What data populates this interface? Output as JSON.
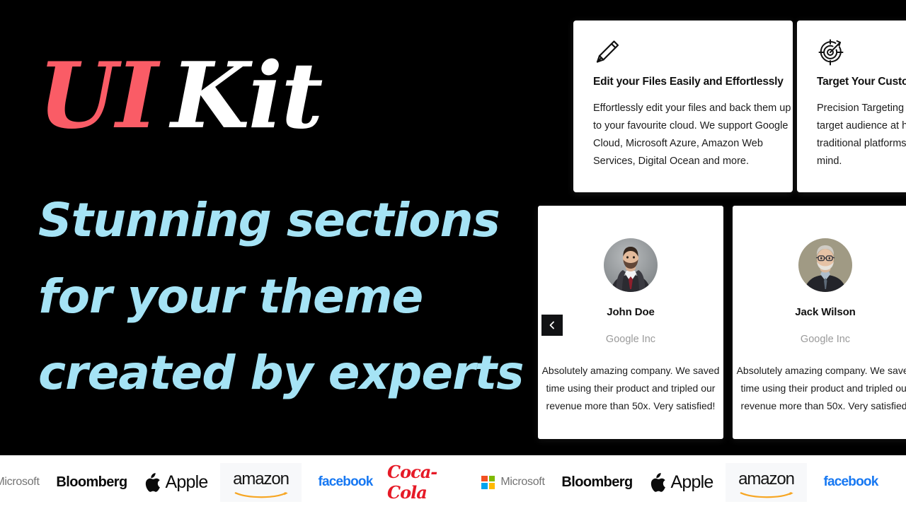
{
  "hero": {
    "title_part1": "UI",
    "title_part2": "Kit",
    "title_color_1": "#FA5C66",
    "title_color_2": "#FFFFFF",
    "subtitle_color": "#A5E3F5",
    "subtitle_lines": [
      "Stunning sections",
      "for your theme",
      "created by experts"
    ]
  },
  "features": [
    {
      "icon": "pencil-icon",
      "title": "Edit your Files Easily and Effortlessly",
      "body": "Effortlessly edit your files and back them up to your favourite cloud. We support Google Cloud, Microsoft Azure, Amazon Web Services, Digital Ocean and more."
    },
    {
      "icon": "target-icon",
      "title": "Target Your Customers",
      "body": "Precision Targeting allows you to reach your target audience at half the cost charged by traditional platforms and with enhanced mind."
    }
  ],
  "testimonials": {
    "prev_label": "‹",
    "items": [
      {
        "avatar": "avatar-john-doe",
        "name": "John Doe",
        "company": "Google Inc",
        "quote": "Absolutely amazing company. We saved time using their product and tripled our revenue more than 50x. Very satisfied!"
      },
      {
        "avatar": "avatar-jack-wilson",
        "name": "Jack Wilson",
        "company": "Google Inc",
        "quote": "Absolutely amazing company. We saved time using their product and tripled our revenue more than 50x. Very satisfied!"
      }
    ]
  },
  "logobar": {
    "background": "#FFFFFF",
    "logos": [
      {
        "name": "microsoft",
        "label": "Microsoft",
        "style": "microsoft",
        "color": "#737373"
      },
      {
        "name": "bloomberg",
        "label": "Bloomberg",
        "style": "bloomberg",
        "color": "#0B0B0B"
      },
      {
        "name": "apple",
        "label": "Apple",
        "style": "apple",
        "color": "#0B0B0B"
      },
      {
        "name": "amazon",
        "label": "amazon",
        "style": "amazon",
        "color": "#141414"
      },
      {
        "name": "facebook",
        "label": "facebook",
        "style": "facebook",
        "color": "#1778F2"
      },
      {
        "name": "coca-cola",
        "label": "Coca-Cola",
        "style": "coca",
        "color": "#E61A27"
      },
      {
        "name": "microsoft",
        "label": "Microsoft",
        "style": "microsoft",
        "color": "#737373"
      },
      {
        "name": "bloomberg",
        "label": "Bloomberg",
        "style": "bloomberg",
        "color": "#0B0B0B"
      },
      {
        "name": "apple",
        "label": "Apple",
        "style": "apple",
        "color": "#0B0B0B"
      },
      {
        "name": "amazon",
        "label": "amazon",
        "style": "amazon",
        "color": "#141414"
      },
      {
        "name": "facebook",
        "label": "facebook",
        "style": "facebook",
        "color": "#1778F2"
      }
    ]
  }
}
